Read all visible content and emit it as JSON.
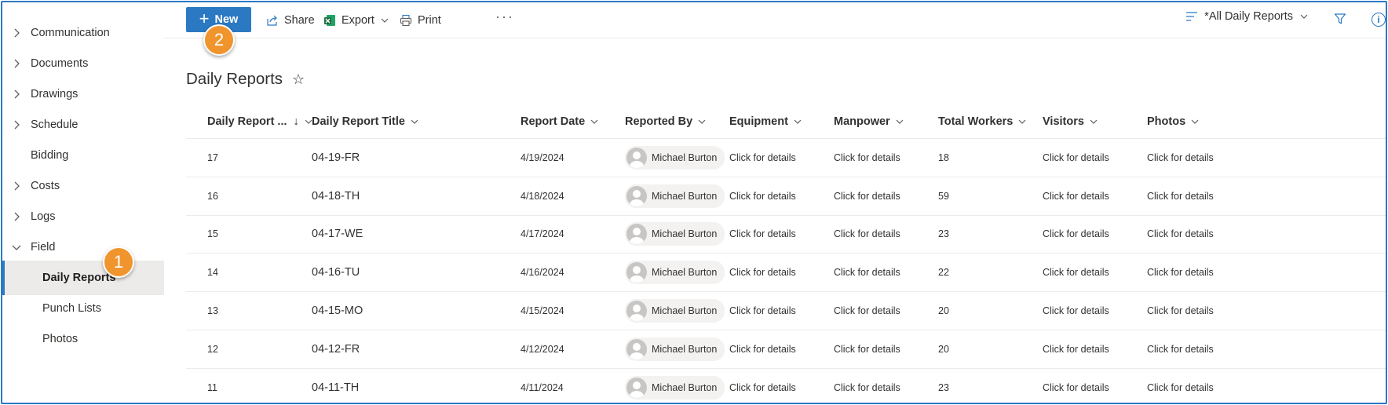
{
  "sidebar": {
    "items": [
      {
        "label": "Communication",
        "expandable": true,
        "expanded": false
      },
      {
        "label": "Documents",
        "expandable": true,
        "expanded": false
      },
      {
        "label": "Drawings",
        "expandable": true,
        "expanded": false
      },
      {
        "label": "Schedule",
        "expandable": true,
        "expanded": false
      },
      {
        "label": "Bidding",
        "expandable": false
      },
      {
        "label": "Costs",
        "expandable": true,
        "expanded": false
      },
      {
        "label": "Logs",
        "expandable": true,
        "expanded": false
      },
      {
        "label": "Field",
        "expandable": true,
        "expanded": true
      },
      {
        "label": "Daily Reports",
        "child": true,
        "active": true
      },
      {
        "label": "Punch Lists",
        "child": true
      },
      {
        "label": "Photos",
        "child": true
      }
    ]
  },
  "toolbar": {
    "new_label": "New",
    "share_label": "Share",
    "export_label": "Export",
    "print_label": "Print",
    "more_label": "···",
    "view_label": "*All Daily Reports"
  },
  "page": {
    "title": "Daily Reports"
  },
  "table": {
    "columns": [
      "Daily Report ...",
      "Daily Report Title",
      "Report Date",
      "Reported By",
      "Equipment",
      "Manpower",
      "Total Workers",
      "Visitors",
      "Photos"
    ],
    "rows": [
      {
        "id": "17",
        "title": "04-19-FR",
        "date": "4/19/2024",
        "by": "Michael Burton",
        "equipment": "Click for details",
        "manpower": "Click for details",
        "workers": "18",
        "visitors": "Click for details",
        "photos": "Click for details"
      },
      {
        "id": "16",
        "title": "04-18-TH",
        "date": "4/18/2024",
        "by": "Michael Burton",
        "equipment": "Click for details",
        "manpower": "Click for details",
        "workers": "59",
        "visitors": "Click for details",
        "photos": "Click for details"
      },
      {
        "id": "15",
        "title": "04-17-WE",
        "date": "4/17/2024",
        "by": "Michael Burton",
        "equipment": "Click for details",
        "manpower": "Click for details",
        "workers": "23",
        "visitors": "Click for details",
        "photos": "Click for details"
      },
      {
        "id": "14",
        "title": "04-16-TU",
        "date": "4/16/2024",
        "by": "Michael Burton",
        "equipment": "Click for details",
        "manpower": "Click for details",
        "workers": "22",
        "visitors": "Click for details",
        "photos": "Click for details"
      },
      {
        "id": "13",
        "title": "04-15-MO",
        "date": "4/15/2024",
        "by": "Michael Burton",
        "equipment": "Click for details",
        "manpower": "Click for details",
        "workers": "20",
        "visitors": "Click for details",
        "photos": "Click for details"
      },
      {
        "id": "12",
        "title": "04-12-FR",
        "date": "4/12/2024",
        "by": "Michael Burton",
        "equipment": "Click for details",
        "manpower": "Click for details",
        "workers": "20",
        "visitors": "Click for details",
        "photos": "Click for details"
      },
      {
        "id": "11",
        "title": "04-11-TH",
        "date": "4/11/2024",
        "by": "Michael Burton",
        "equipment": "Click for details",
        "manpower": "Click for details",
        "workers": "23",
        "visitors": "Click for details",
        "photos": "Click for details"
      }
    ]
  },
  "callouts": [
    {
      "number": "1"
    },
    {
      "number": "2"
    }
  ],
  "colors": {
    "accent": "#2b79c2",
    "callout": "#f0952e",
    "excel_green": "#1d6f42"
  }
}
